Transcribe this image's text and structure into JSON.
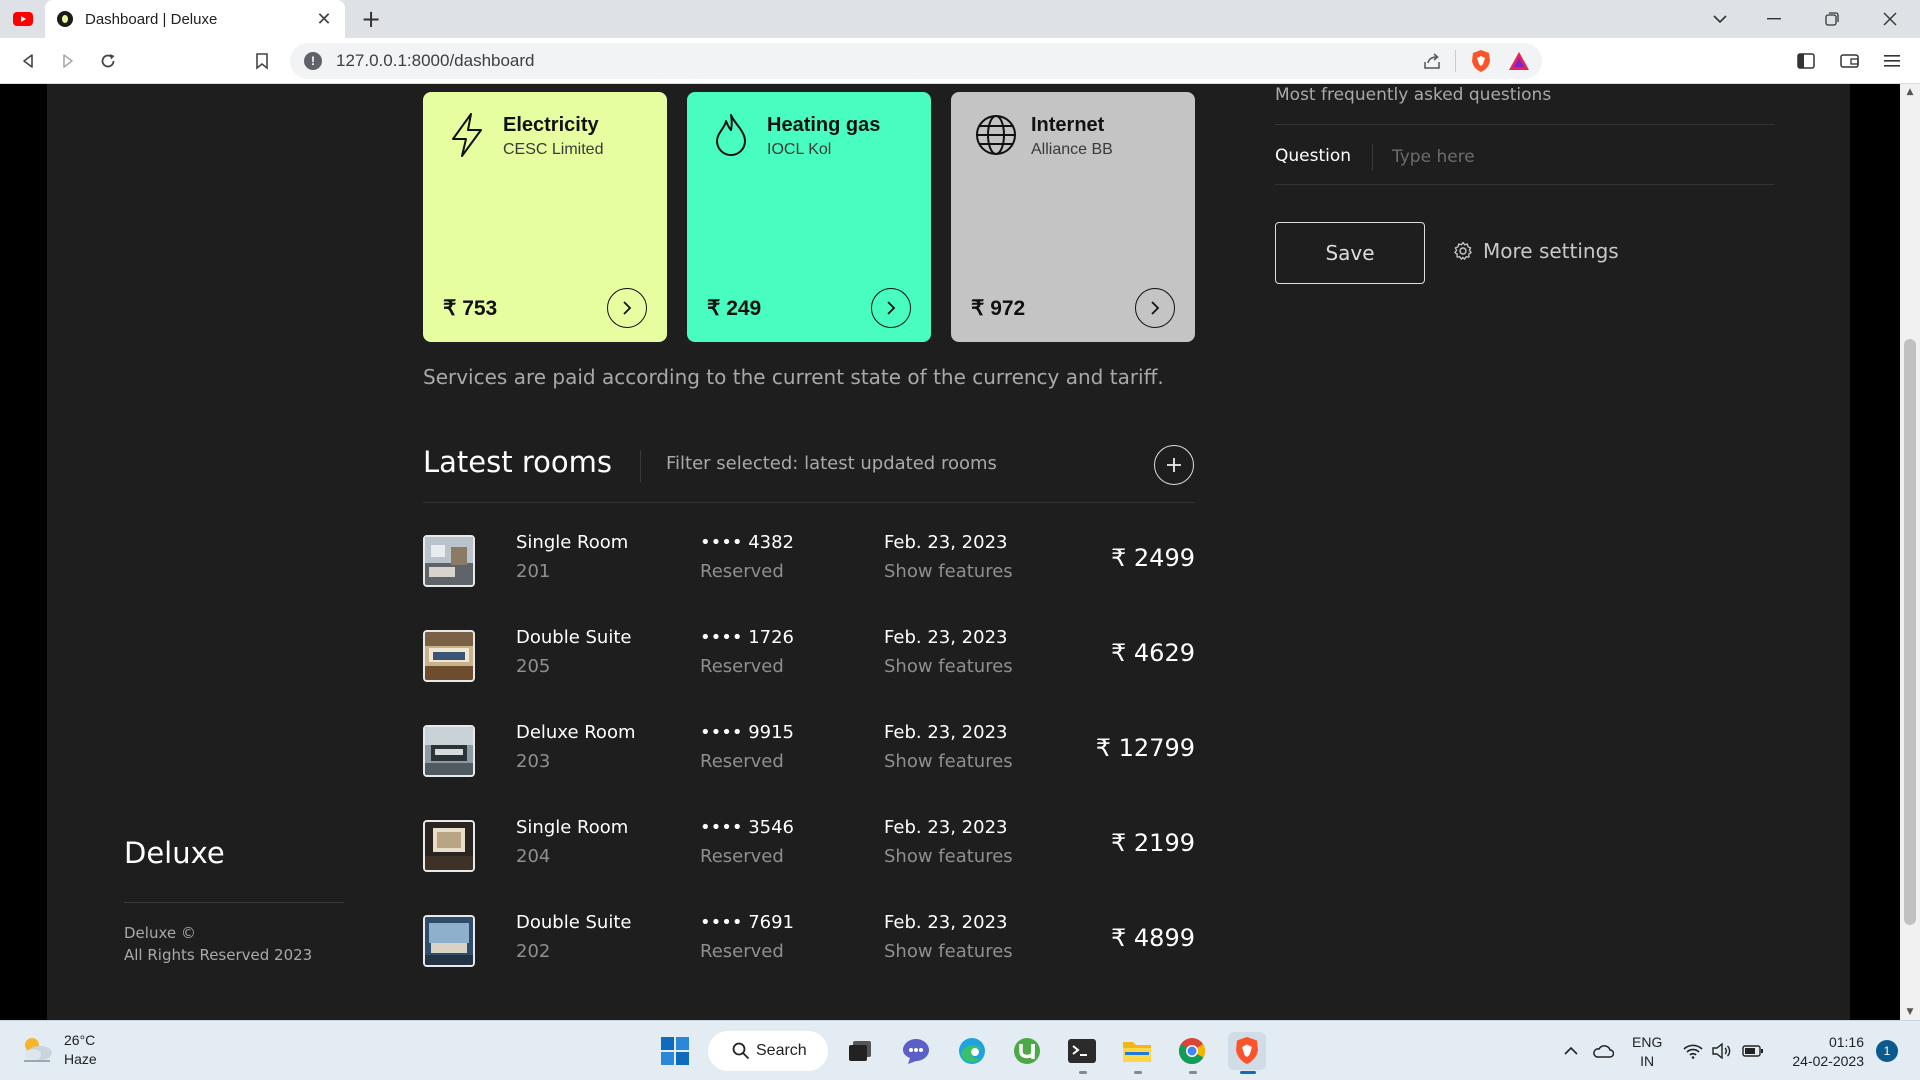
{
  "browser": {
    "tab_title": "Dashboard | Deluxe",
    "tab_close": "✕",
    "new_tab": "+",
    "url": "127.0.0.1:8000/dashboard",
    "info_glyph": "!"
  },
  "services": [
    {
      "title": "Electricity",
      "provider": "CESC Limited",
      "amount": "₹ 753",
      "color": "#e6fda0",
      "icon": "lightning-icon"
    },
    {
      "title": "Heating gas",
      "provider": "IOCL Kol",
      "amount": "₹ 249",
      "color": "#48fdc0",
      "icon": "flame-icon"
    },
    {
      "title": "Internet",
      "provider": "Alliance BB",
      "amount": "₹ 972",
      "color": "#c4c4c4",
      "icon": "globe-icon"
    }
  ],
  "services_note": "Services are paid according to the current state of the currency and tariff.",
  "rooms": {
    "title": "Latest rooms",
    "filter": "Filter selected: latest updated rooms",
    "items": [
      {
        "name": "Single Room",
        "number": "201",
        "card": "•••• 4382",
        "status": "Reserved",
        "date": "Feb. 23, 2023",
        "features": "Show features",
        "price": "₹ 2499"
      },
      {
        "name": "Double Suite",
        "number": "205",
        "card": "•••• 1726",
        "status": "Reserved",
        "date": "Feb. 23, 2023",
        "features": "Show features",
        "price": "₹ 4629"
      },
      {
        "name": "Deluxe Room",
        "number": "203",
        "card": "•••• 9915",
        "status": "Reserved",
        "date": "Feb. 23, 2023",
        "features": "Show features",
        "price": "₹ 12799"
      },
      {
        "name": "Single Room",
        "number": "204",
        "card": "•••• 3546",
        "status": "Reserved",
        "date": "Feb. 23, 2023",
        "features": "Show features",
        "price": "₹ 2199"
      },
      {
        "name": "Double Suite",
        "number": "202",
        "card": "•••• 7691",
        "status": "Reserved",
        "date": "Feb. 23, 2023",
        "features": "Show features",
        "price": "₹ 4899"
      }
    ]
  },
  "faq": {
    "title": "Most frequently asked questions",
    "question_label": "Question",
    "question_placeholder": "Type here",
    "save_label": "Save",
    "more_settings_label": "More settings"
  },
  "sidebar": {
    "brand": "Deluxe",
    "copyright_line1": "Deluxe ©",
    "copyright_line2": "All Rights Reserved 2023"
  },
  "taskbar": {
    "temperature": "26°C",
    "weather": "Haze",
    "search_label": "Search",
    "lang_line1": "ENG",
    "lang_line2": "IN",
    "time": "01:16",
    "date": "24-02-2023",
    "notifications": "1"
  }
}
